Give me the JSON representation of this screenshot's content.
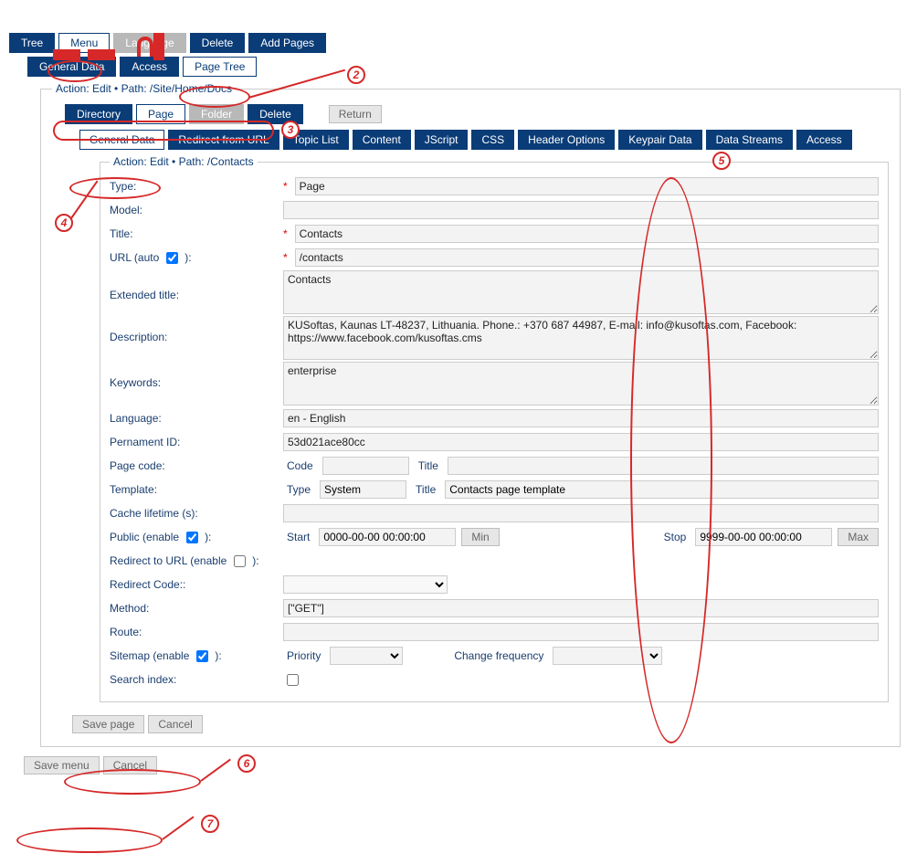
{
  "topTabs": {
    "tree": "Tree",
    "menu": "Menu",
    "language": "Language",
    "delete": "Delete",
    "addPages": "Add Pages"
  },
  "subTabs": {
    "generalData": "General Data",
    "access": "Access",
    "pageTree": "Page Tree"
  },
  "outer": {
    "legend": "Action: Edit • Path: /Site/Home/Docs",
    "tabs": {
      "directory": "Directory",
      "page": "Page",
      "folder": "Folder",
      "delete": "Delete",
      "return": "Return"
    },
    "subTabs": {
      "generalData": "General Data",
      "redirect": "Redirect from URL",
      "topicList": "Topic List",
      "content": "Content",
      "jscript": "JScript",
      "css": "CSS",
      "headerOptions": "Header Options",
      "keypair": "Keypair Data",
      "dataStreams": "Data Streams",
      "access": "Access"
    }
  },
  "inner": {
    "legend": "Action: Edit • Path: /Contacts",
    "labels": {
      "type": "Type:",
      "model": "Model:",
      "title": "Title:",
      "url_pre": "URL (auto",
      "url_post": "):",
      "extendedTitle": "Extended title:",
      "description": "Description:",
      "keywords": "Keywords:",
      "language": "Language:",
      "permId": "Pernament ID:",
      "pageCode": "Page code:",
      "code": "Code",
      "titleSub": "Title",
      "template": "Template:",
      "typeSub": "Type",
      "cacheLifetime": "Cache lifetime (s):",
      "public_pre": "Public (enable",
      "public_post": "):",
      "start": "Start",
      "min": "Min",
      "stop": "Stop",
      "max": "Max",
      "redirectUrl_pre": "Redirect to URL (enable",
      "redirectUrl_post": "):",
      "redirectCode": "Redirect Code::",
      "method": "Method:",
      "route": "Route:",
      "sitemap_pre": "Sitemap (enable",
      "sitemap_post": "):",
      "priority": "Priority",
      "changeFreq": "Change frequency",
      "searchIndex": "Search index:"
    },
    "values": {
      "type": "Page",
      "model": "",
      "title": "Contacts",
      "url": "/contacts",
      "extendedTitle": "Contacts",
      "description": "KUSoftas, Kaunas LT-48237, Lithuania. Phone.: +370 687 44987, E-mail: info@kusoftas.com, Facebook: https://www.facebook.com/kusoftas.cms",
      "keywords": "enterprise",
      "language": "en - English",
      "permId": "53d021ace80cc",
      "pageCode_code": "",
      "pageCode_title": "",
      "template_type": "System",
      "template_title": "Contacts page template",
      "cacheLifetime": "",
      "publicStart": "0000-00-00 00:00:00",
      "publicStop": "9999-00-00 00:00:00",
      "method": "[\"GET\"]",
      "route": ""
    }
  },
  "buttons": {
    "savePage": "Save page",
    "cancel": "Cancel",
    "saveMenu": "Save menu"
  },
  "callouts": {
    "c2": "2",
    "c3": "3",
    "c4": "4",
    "c5": "5",
    "c6": "6",
    "c7": "7"
  }
}
